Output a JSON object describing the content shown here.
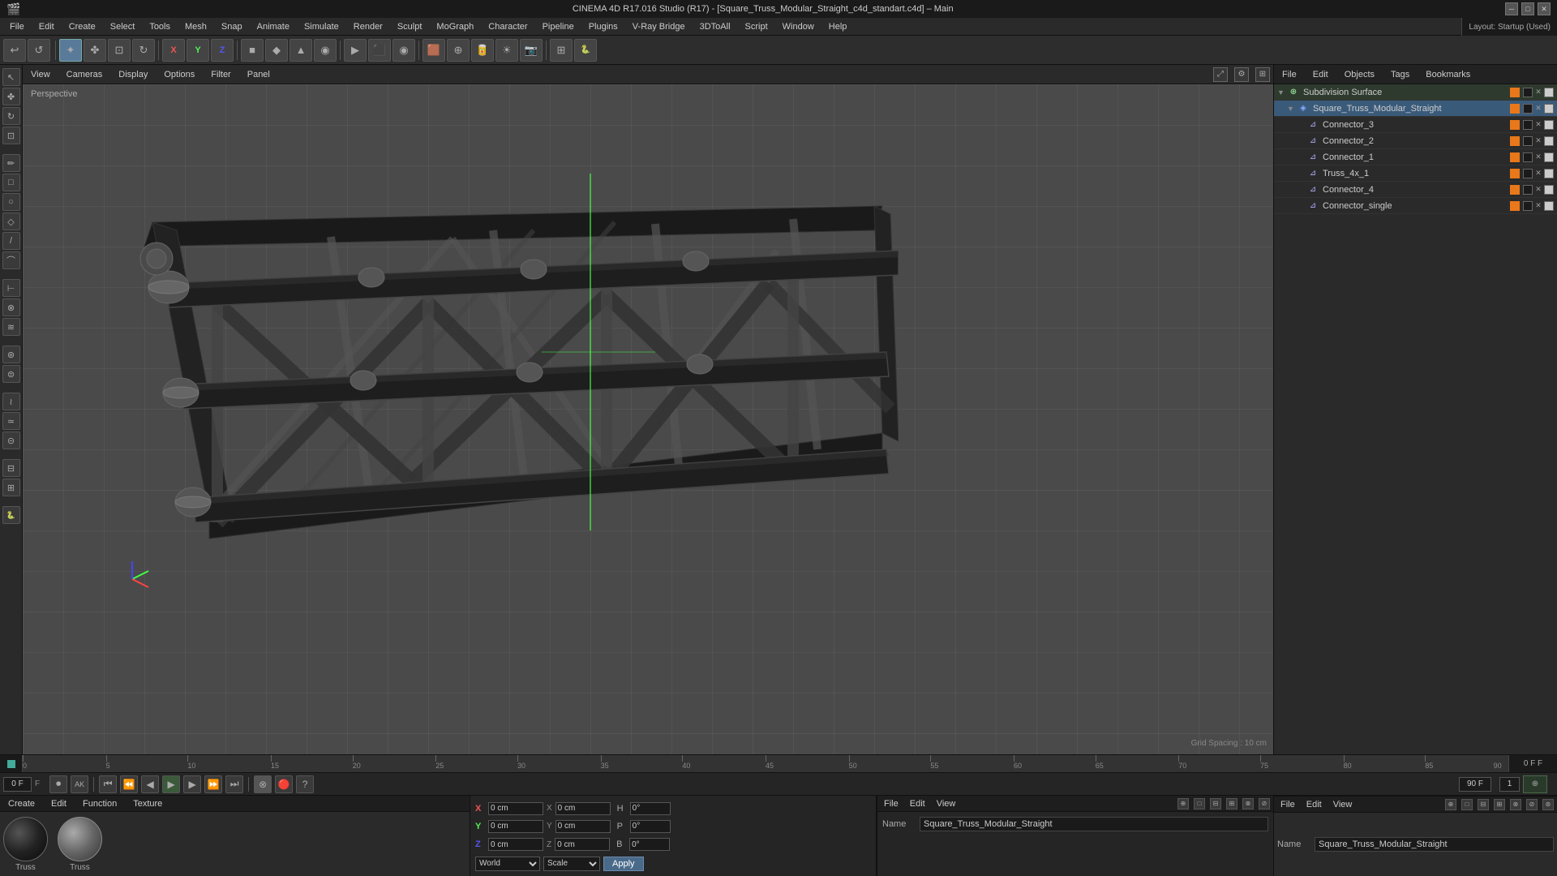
{
  "titlebar": {
    "title": "CINEMA 4D R17.016 Studio (R17) - [Square_Truss_Modular_Straight_c4d_standart.c4d] – Main",
    "layout_label": "Layout: Startup (Used)"
  },
  "menubar": {
    "items": [
      "File",
      "Edit",
      "Create",
      "Select",
      "Tools",
      "Mesh",
      "Snap",
      "Animate",
      "Simulate",
      "Render",
      "Sculpt",
      "MoGraph",
      "Character",
      "Pipeline",
      "Plugins",
      "V-Ray Bridge",
      "3DToAll",
      "Script",
      "Window",
      "Help"
    ]
  },
  "toolbar": {
    "mode_tools": [
      "↩",
      "↺",
      "✦",
      "⊕"
    ],
    "transform_tools": [
      "✤",
      "↕",
      "⊞",
      "⊡"
    ],
    "xzy_labels": [
      "X",
      "Y",
      "Z"
    ],
    "shape_tools": [
      "■",
      "◆",
      "▲",
      "◉",
      "⊗",
      "≋",
      "⊕",
      "⊘"
    ],
    "render_tools": [
      "▶",
      "⬛",
      "◉",
      "●"
    ],
    "snap_tools": [
      "⊡",
      "⊞",
      "⊟"
    ],
    "misc_tools": [
      "☀",
      "⚙",
      "🐍"
    ]
  },
  "viewport": {
    "perspective_label": "Perspective",
    "grid_spacing": "Grid Spacing : 10 cm",
    "menus": [
      "View",
      "Cameras",
      "Display",
      "Options",
      "Filter",
      "Panel"
    ]
  },
  "timeline": {
    "frame_current": "0 F",
    "frame_start": "0 F",
    "frame_end": "90 F",
    "ticks": [
      0,
      5,
      10,
      15,
      20,
      25,
      30,
      35,
      40,
      45,
      50,
      55,
      60,
      65,
      70,
      75,
      80,
      85,
      90
    ]
  },
  "playback": {
    "current_frame": "0 F",
    "total_frames": "90 F",
    "fps": "1",
    "start_frame": "0 F",
    "end_frame": "90 F"
  },
  "object_manager": {
    "header_buttons": [
      "File",
      "Edit",
      "Objects",
      "Tags",
      "Bookmarks"
    ],
    "objects": [
      {
        "name": "Subdivision Surface",
        "level": 0,
        "type": "subdivision",
        "has_children": true,
        "selected": false
      },
      {
        "name": "Square_Truss_Modular_Straight",
        "level": 1,
        "type": "group",
        "has_children": true,
        "selected": true
      },
      {
        "name": "Connector_3",
        "level": 2,
        "type": "object",
        "has_children": false,
        "selected": false
      },
      {
        "name": "Connector_2",
        "level": 2,
        "type": "object",
        "has_children": false,
        "selected": false
      },
      {
        "name": "Connector_1",
        "level": 2,
        "type": "object",
        "has_children": false,
        "selected": false
      },
      {
        "name": "Truss_4x_1",
        "level": 2,
        "type": "object",
        "has_children": false,
        "selected": false
      },
      {
        "name": "Connector_4",
        "level": 2,
        "type": "object",
        "has_children": false,
        "selected": false
      },
      {
        "name": "Connector_single",
        "level": 2,
        "type": "object",
        "has_children": false,
        "selected": false
      }
    ]
  },
  "materials": {
    "header_buttons": [
      "Create",
      "Edit",
      "Function",
      "Texture"
    ],
    "items": [
      {
        "name": "Truss",
        "type": "dark"
      },
      {
        "name": "Truss",
        "type": "light"
      }
    ]
  },
  "coordinates": {
    "x": {
      "pos": "0 cm",
      "size": "0 cm"
    },
    "y": {
      "pos": "0 cm",
      "size": "0 cm"
    },
    "z": {
      "pos": "0 cm",
      "size": "0 cm"
    },
    "space": "World",
    "mode": "Scale",
    "apply_label": "Apply",
    "labels": {
      "H": "H",
      "P": "P",
      "B": "B"
    },
    "rot_x": "0°",
    "rot_y": "0°",
    "rot_z": "0°"
  },
  "obj_props": {
    "header_buttons": [
      "File",
      "Edit",
      "View"
    ],
    "name_label": "Name",
    "name_value": "Square_Truss_Modular_Straight"
  }
}
